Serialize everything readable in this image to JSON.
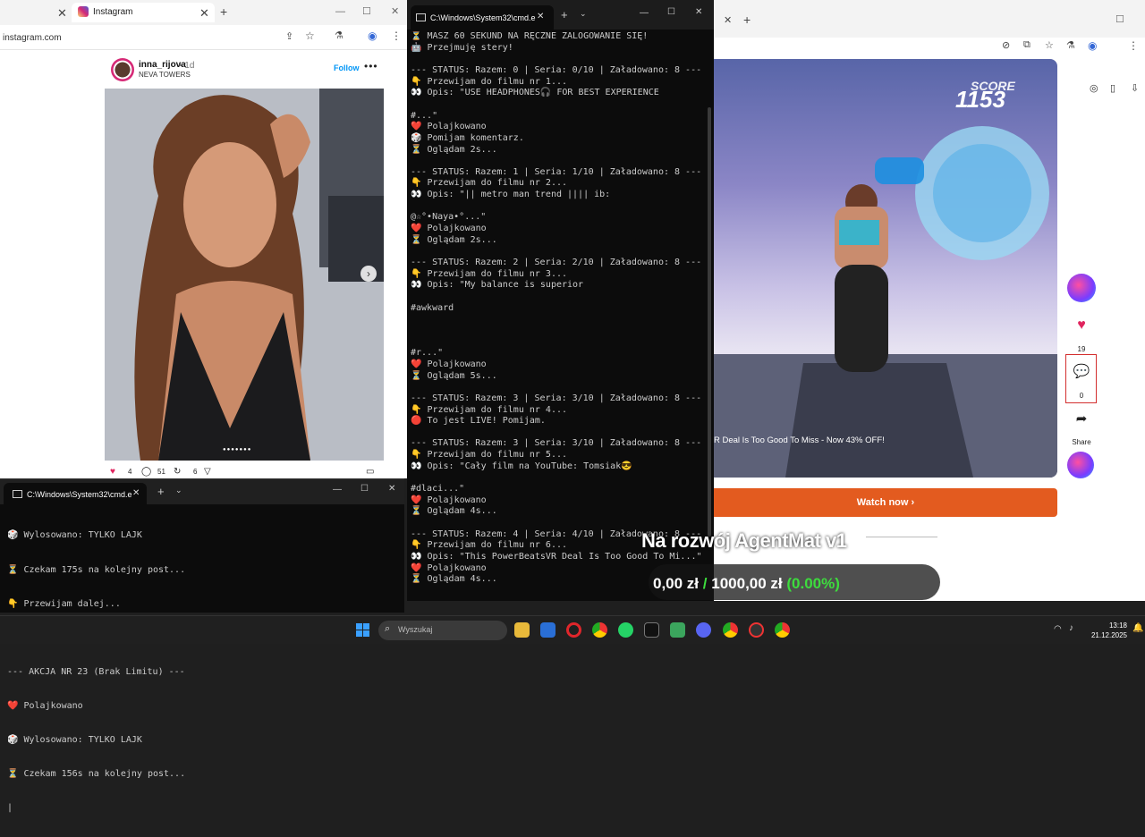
{
  "ig_browser": {
    "tab_title": "Instagram",
    "url": "instagram.com",
    "post": {
      "username": "inna_rijova",
      "time": "• 1d",
      "location": "NEVA TOWERS",
      "follow_label": "Follow",
      "more_label": "•••",
      "likes": "4",
      "comments": "51",
      "shares": "6",
      "carousel_dots": "●●●●●●●"
    }
  },
  "cmd_main": {
    "title": "C:\\Windows\\System32\\cmd.e",
    "lines": [
      "⏳ MASZ 60 SEKUND NA RĘCZNE ZALOGOWANIE SIĘ!",
      "🤖 Przejmuję stery!",
      "",
      "--- STATUS: Razem: 0 | Seria: 0/10 | Załadowano: 8 ---",
      "👇 Przewijam do filmu nr 1...",
      "👀 Opis: \"USE HEADPHONES🎧 FOR BEST EXPERIENCE",
      "",
      "#...\"",
      "❤️ Polajkowano",
      "🎲 Pomijam komentarz.",
      "⏳ Oglądam 2s...",
      "",
      "--- STATUS: Razem: 1 | Seria: 1/10 | Załadowano: 8 ---",
      "👇 Przewijam do filmu nr 2...",
      "👀 Opis: \"|| metro man trend |||| ib:",
      "",
      "@☆°•Naya•°...\"",
      "❤️ Polajkowano",
      "⏳ Oglądam 2s...",
      "",
      "--- STATUS: Razem: 2 | Seria: 2/10 | Załadowano: 8 ---",
      "👇 Przewijam do filmu nr 3...",
      "👀 Opis: \"My balance is superior",
      "",
      "#awkward",
      "",
      "",
      "",
      "#r...\"",
      "❤️ Polajkowano",
      "⏳ Oglądam 5s...",
      "",
      "--- STATUS: Razem: 3 | Seria: 3/10 | Załadowano: 8 ---",
      "👇 Przewijam do filmu nr 4...",
      "🔴 To jest LIVE! Pomijam.",
      "",
      "--- STATUS: Razem: 3 | Seria: 3/10 | Załadowano: 8 ---",
      "👇 Przewijam do filmu nr 5...",
      "👀 Opis: \"Cały film na YouTube: Tomsiak😎",
      "",
      "#dlaci...\"",
      "❤️ Polajkowano",
      "⏳ Oglądam 4s...",
      "",
      "--- STATUS: Razem: 4 | Seria: 4/10 | Załadowano: 8 ---",
      "👇 Przewijam do filmu nr 6...",
      "👀 Opis: \"This PowerBeatsVR Deal Is Too Good To Mi...\"",
      "❤️ Polajkowano",
      "⏳ Oglądam 4s...",
      ""
    ]
  },
  "cmd_small": {
    "title": "C:\\Windows\\System32\\cmd.e",
    "lines": [
      "🎲 Wylosowano: TYLKO LAJK",
      "⏳ Czekam 175s na kolejny post...",
      "👇 Przewijam dalej...",
      "",
      "--- AKCJA NR 23 (Brak Limitu) ---",
      "❤️ Polajkowano",
      "🎲 Wylosowano: TYLKO LAJK",
      "⏳ Czekam 156s na kolejny post...",
      ""
    ]
  },
  "right_browser": {
    "score_label": "SCORE",
    "score_value": "1153",
    "ad_text": "R Deal Is Too Good To Miss - Now 43% OFF!",
    "watch_label": "Watch now",
    "likes": "19",
    "comments": "0",
    "share_label": "Share"
  },
  "overlay": {
    "title": "Na rozwój AgentMat v1",
    "amount": "0,00 zł",
    "separator": "/",
    "goal": "1000,00 zł",
    "percent": "(0.00%)"
  },
  "taskbar": {
    "search_placeholder": "Wyszukaj",
    "time": "13:18",
    "date": "21.12.2025"
  }
}
